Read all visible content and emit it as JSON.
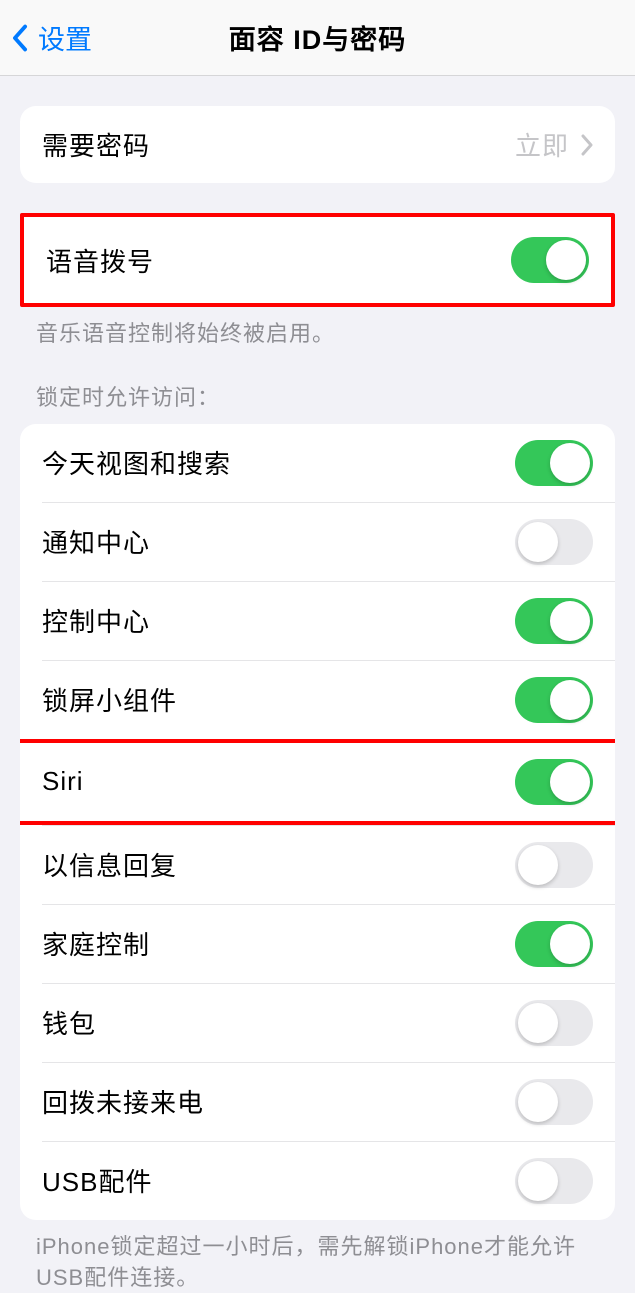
{
  "nav": {
    "back_label": "设置",
    "title": "面容 ID与密码"
  },
  "passcode_group": {
    "require_passcode": {
      "label": "需要密码",
      "value": "立即"
    }
  },
  "voice_dial": {
    "label": "语音拨号",
    "on": true,
    "footer": "音乐语音控制将始终被启用。"
  },
  "lock_access": {
    "header": "锁定时允许访问：",
    "items": [
      {
        "label": "今天视图和搜索",
        "on": true
      },
      {
        "label": "通知中心",
        "on": false
      },
      {
        "label": "控制中心",
        "on": true
      },
      {
        "label": "锁屏小组件",
        "on": true
      },
      {
        "label": "Siri",
        "on": true,
        "highlighted": true
      },
      {
        "label": "以信息回复",
        "on": false
      },
      {
        "label": "家庭控制",
        "on": true
      },
      {
        "label": "钱包",
        "on": false
      },
      {
        "label": "回拨未接来电",
        "on": false
      },
      {
        "label": "USB配件",
        "on": false
      }
    ],
    "footer": "iPhone锁定超过一小时后，需先解锁iPhone才能允许USB配件连接。"
  }
}
